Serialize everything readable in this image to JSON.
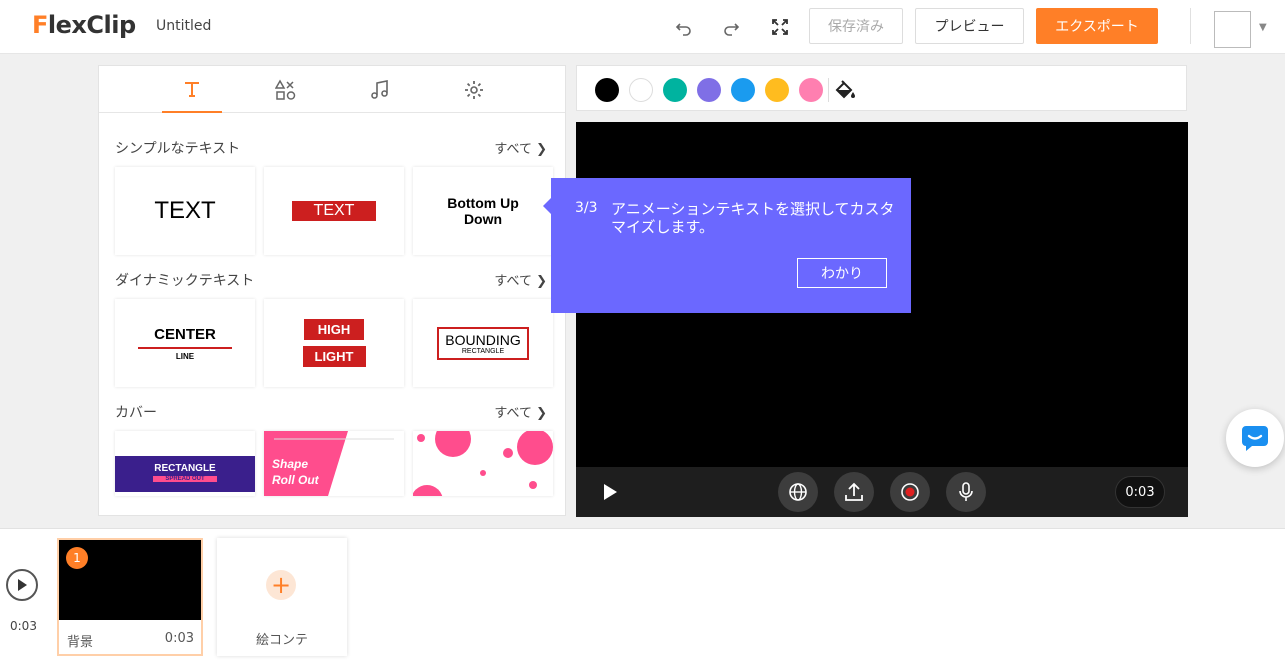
{
  "app": {
    "logo_prefix": "F",
    "logo_rest": "lexClip",
    "doc_title": "Untitled"
  },
  "toolbar": {
    "saved_label": "保存済み",
    "preview_label": "プレビュー",
    "export_label": "エクスポート"
  },
  "sections": [
    {
      "title": "シンプルなテキスト",
      "all": "すべて"
    },
    {
      "title": "ダイナミックテキスト",
      "all": "すべて"
    },
    {
      "title": "カバー",
      "all": "すべて"
    }
  ],
  "cards": {
    "text1": "TEXT",
    "text2": "TEXT",
    "text3_line1": "Bottom Up",
    "text3_line2": "Down",
    "center_line1": "CENTER",
    "center_line2": "LINE",
    "high": "HIGH",
    "light": "LIGHT",
    "bounding_line1": "BOUNDING",
    "bounding_line2": "RECTANGLE",
    "rect_line1": "RECTANGLE",
    "rect_line2": "SPREAD OUT",
    "shape_line1": "Shape",
    "shape_line2": "Roll Out"
  },
  "colors": [
    "#000000",
    "#ffffff",
    "#00b39f",
    "#7f6fe6",
    "#1a9bef",
    "#ffbc1f",
    "#ff7fb0"
  ],
  "accent": "#ff7f27",
  "tooltip": {
    "step": "3/3",
    "text": "アニメーションテキストを選択してカスタマイズします。",
    "button": "わかり"
  },
  "player": {
    "time": "0:03"
  },
  "timeline": {
    "time": "0:03",
    "clip_number": "1",
    "clip_name": "背景",
    "clip_duration": "0:03",
    "storyboard_label": "絵コンテ"
  }
}
